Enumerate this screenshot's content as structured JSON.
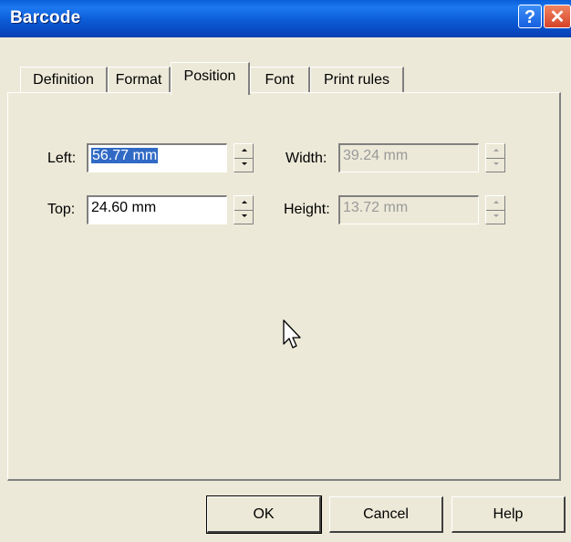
{
  "window": {
    "title": "Barcode"
  },
  "tabs": [
    {
      "label": "Definition"
    },
    {
      "label": "Format"
    },
    {
      "label": "Position",
      "active": true
    },
    {
      "label": "Font"
    },
    {
      "label": "Print rules"
    }
  ],
  "position": {
    "left": {
      "label": "Left:",
      "value": "56.77 mm",
      "selected": true
    },
    "top": {
      "label": "Top:",
      "value": "24.60 mm"
    },
    "width": {
      "label": "Width:",
      "value": "39.24 mm",
      "disabled": true
    },
    "height": {
      "label": "Height:",
      "value": "13.72 mm",
      "disabled": true
    }
  },
  "buttons": {
    "ok": "OK",
    "cancel": "Cancel",
    "help": "Help"
  },
  "titlebar_buttons": {
    "help_glyph": "?",
    "close_glyph": "✕"
  },
  "colors": {
    "titlebar": "#0A5FD8",
    "selection": "#316AC5",
    "dialog_bg": "#ECE9D8"
  }
}
